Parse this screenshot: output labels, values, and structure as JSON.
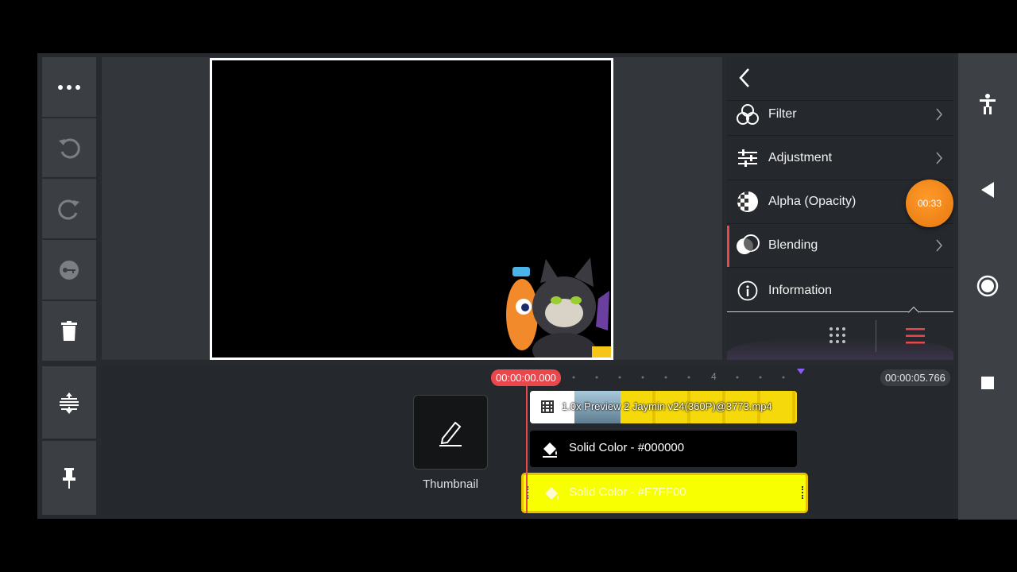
{
  "left_toolbar": {
    "more_icon": "more-icon",
    "undo_icon": "undo-icon",
    "redo_icon": "redo-icon",
    "keyframe_icon": "keyframe-icon",
    "delete_icon": "trash-icon",
    "split_icon": "expand-collapse-icon",
    "pin_icon": "pin-icon"
  },
  "panel": {
    "back_icon": "back-arrow-icon",
    "items": [
      {
        "label": "Filter",
        "icon": "filter-icon"
      },
      {
        "label": "Adjustment",
        "icon": "sliders-icon"
      },
      {
        "label": "Alpha (Opacity)",
        "icon": "checker-icon"
      },
      {
        "label": "Blending",
        "icon": "blend-icon"
      },
      {
        "label": "Information",
        "icon": "info-icon"
      }
    ],
    "recording_timer": "00:33",
    "grid_icon": "grid-icon",
    "menu_icon": "hamburger-icon"
  },
  "timeline": {
    "current_time": "00:00:00.000",
    "end_time": "00:00:05.766",
    "ruler_mark": "4",
    "thumbnail_label": "Thumbnail",
    "tracks": [
      {
        "label": "1.0x Preview 2 Jaymin v24(360P)@3773.mp4",
        "type": "video"
      },
      {
        "label": "Solid Color - #000000",
        "type": "solid",
        "color": "#000000"
      },
      {
        "label": "Solid Color - #F7FF00",
        "type": "solid",
        "color": "#F7FF00"
      }
    ]
  },
  "colors": {
    "accent_red": "#e8474c",
    "orange": "#f08a1c",
    "selected_yellow": "#f7ff00"
  }
}
